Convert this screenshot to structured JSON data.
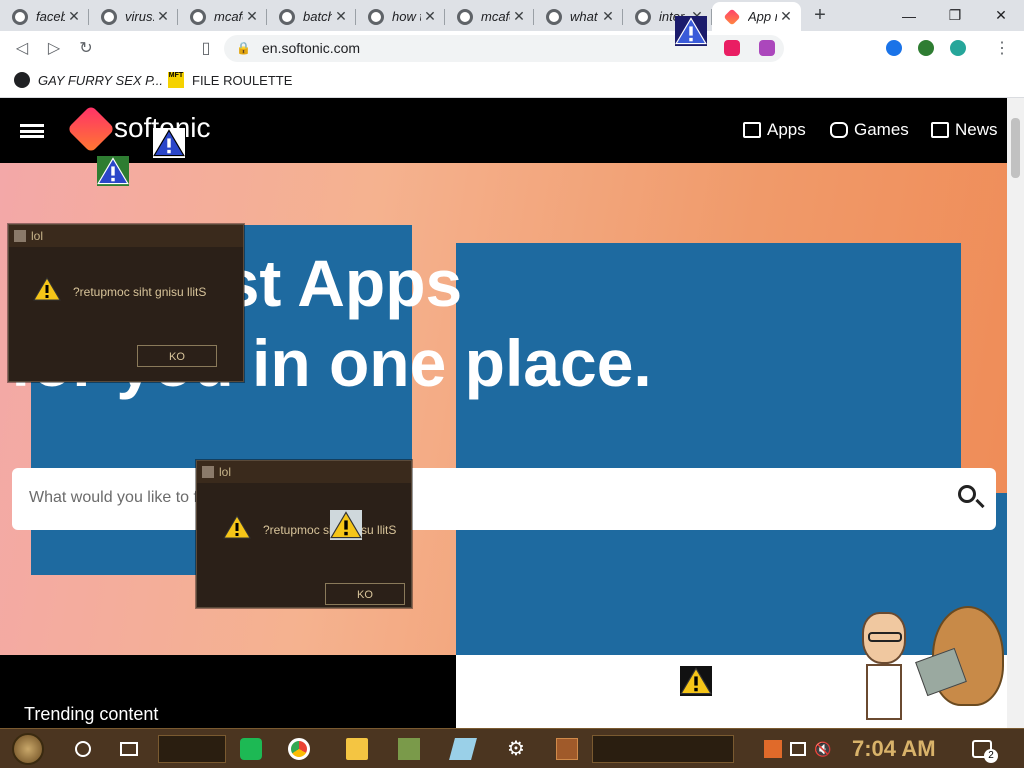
{
  "browser": {
    "tabs": [
      {
        "label": "faceb"
      },
      {
        "label": "virus."
      },
      {
        "label": "mcafe"
      },
      {
        "label": "batch"
      },
      {
        "label": "how t"
      },
      {
        "label": "mcafe"
      },
      {
        "label": "what i"
      },
      {
        "label": "inter"
      },
      {
        "label": "App n"
      }
    ],
    "new_tab": "+",
    "window_controls": {
      "minimize": "—",
      "restore": "❐",
      "close": "✕"
    },
    "url": "en.softonic.com",
    "bookmarks": [
      {
        "label": "GAY FURRY SEX P..."
      },
      {
        "label": "FILE ROULETTE",
        "icon_text": "MFT"
      }
    ]
  },
  "site": {
    "logo": "softonic",
    "nav": [
      {
        "label": "Apps"
      },
      {
        "label": "Games"
      },
      {
        "label": "News"
      }
    ],
    "hero_title_line1": "The best Apps",
    "hero_title_line2": "for you in one place.",
    "search_placeholder": "What would you like to find today?",
    "trending": "Trending content"
  },
  "dialogs": [
    {
      "title": "lol",
      "message": "?retupmoc siht gnisu llitS",
      "button": "KO"
    },
    {
      "title": "lol",
      "message": "?retupmoc siht gnisu llitS",
      "button": "KO"
    }
  ],
  "taskbar": {
    "time": "7:04 AM",
    "notification_count": "2"
  }
}
